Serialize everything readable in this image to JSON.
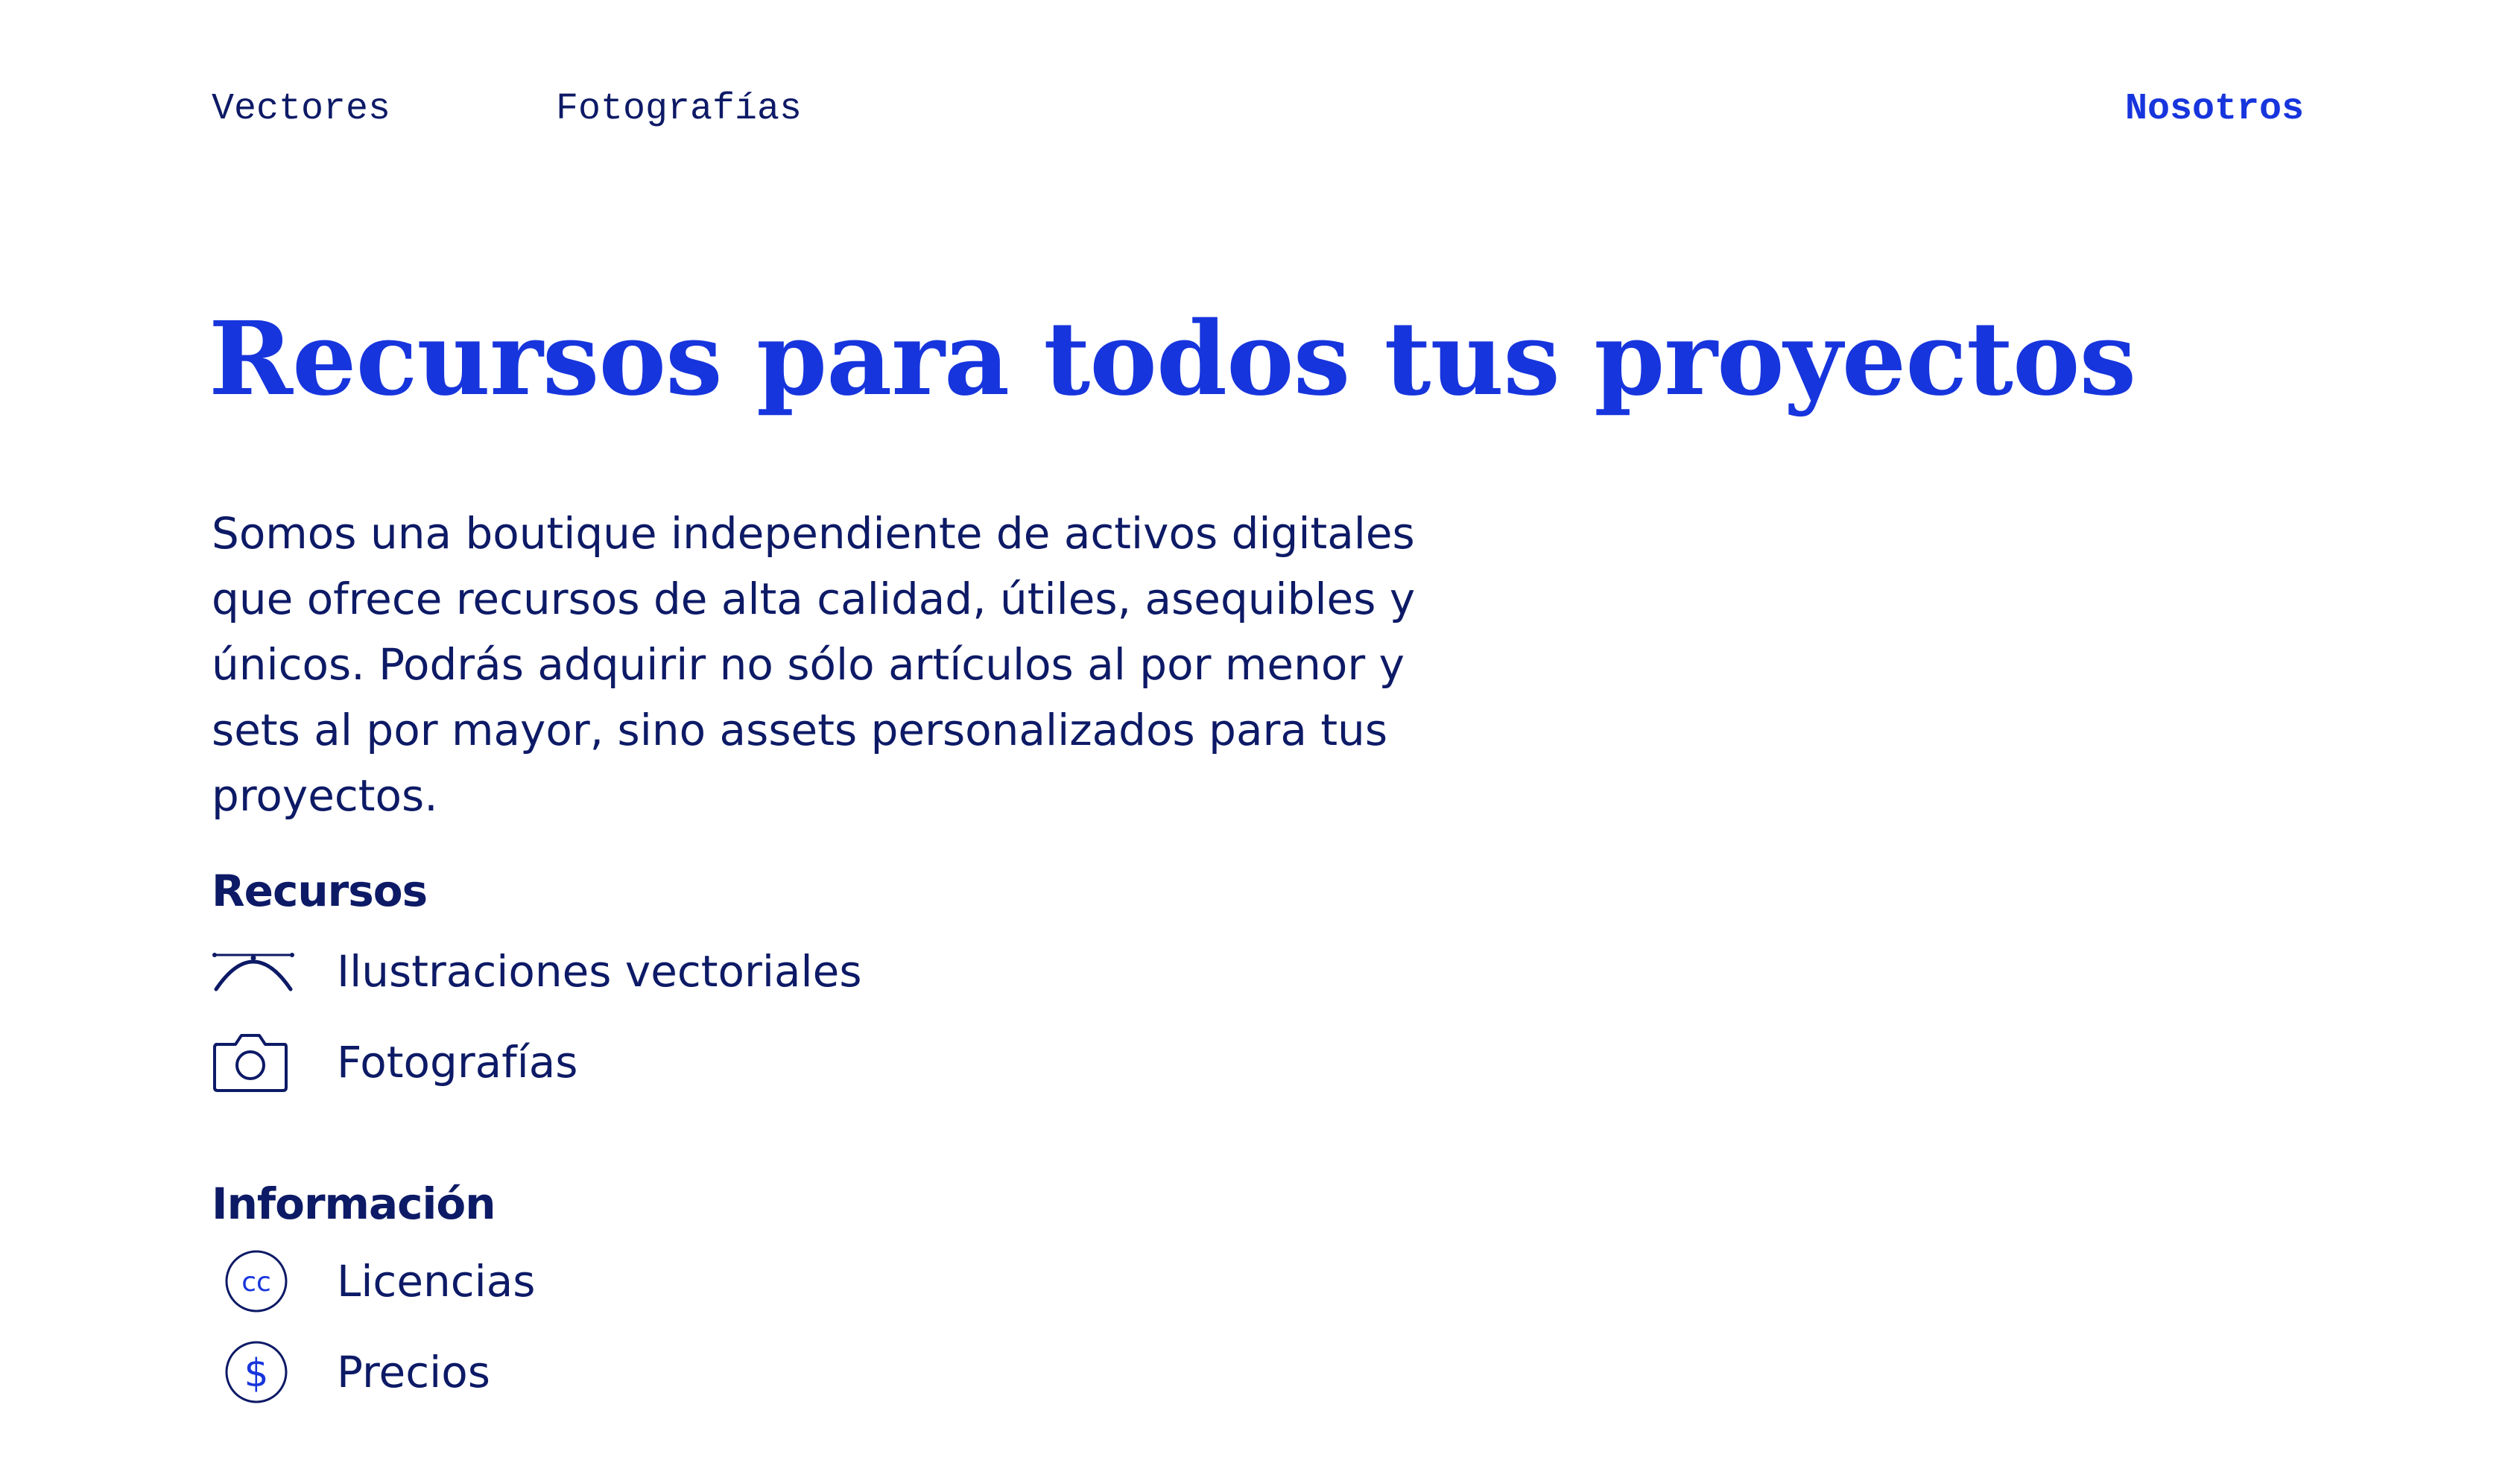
{
  "nav": {
    "vectores": "Vectores",
    "fotografias": "Fotografías",
    "nosotros": "Nosotros"
  },
  "hero": {
    "title": "Recursos para todos tus proyectos",
    "description": "Somos una boutique independiente de activos digitales que ofrece recursos de alta calidad, útiles, asequibles y únicos. Podrás adquirir no sólo artículos al por menor y sets al por mayor, sino assets personalizados para tus proyectos."
  },
  "recursos": {
    "title": "Recursos",
    "items": [
      {
        "label": "Ilustraciones vectoriales",
        "icon": "bezier-curve-icon"
      },
      {
        "label": "Fotografías",
        "icon": "camera-icon"
      }
    ]
  },
  "informacion": {
    "title": "Información",
    "items": [
      {
        "label": "Licencias",
        "icon": "creative-commons-icon",
        "icon_text": "cc"
      },
      {
        "label": "Precios",
        "icon": "dollar-icon",
        "icon_text": "$"
      }
    ]
  },
  "colors": {
    "accent": "#1735dd",
    "text": "#0d1a66",
    "background": "#ffffff"
  }
}
